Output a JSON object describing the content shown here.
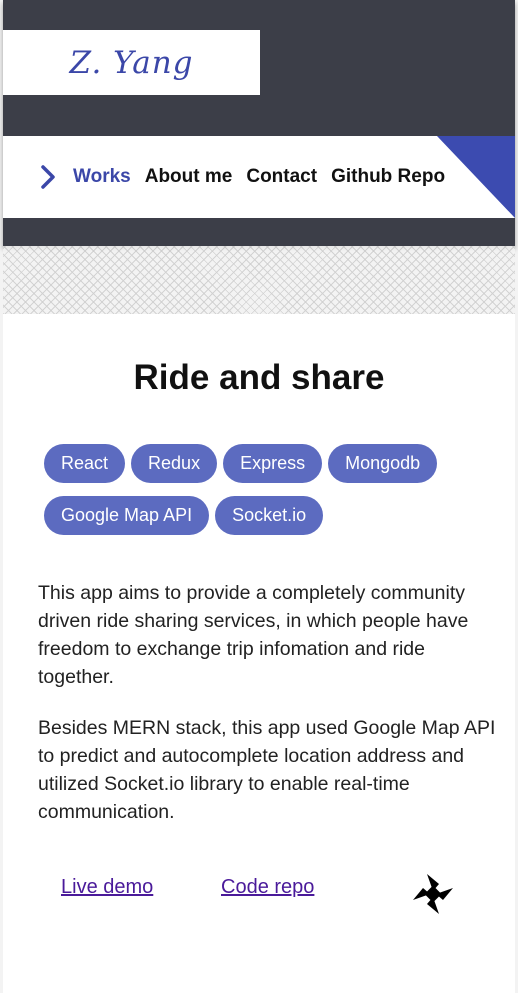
{
  "header": {
    "logo_text": "Z. Yang",
    "nav": {
      "items": [
        {
          "label": "Works",
          "active": true
        },
        {
          "label": "About me",
          "active": false
        },
        {
          "label": "Contact",
          "active": false
        },
        {
          "label": "Github Repo",
          "active": false
        }
      ]
    }
  },
  "project": {
    "title": "Ride and share",
    "tags": [
      "React",
      "Redux",
      "Express",
      "Mongodb",
      "Google Map API",
      "Socket.io"
    ],
    "description": [
      "This app aims to provide a completely community driven ride sharing services, in which people have freedom to exchange trip infomation and ride together.",
      "Besides MERN stack, this app used Google Map API to predict and autocomplete location address and utilized Socket.io library to enable real-time communication."
    ],
    "links": {
      "live_demo": "Live demo",
      "code_repo": "Code repo"
    }
  },
  "colors": {
    "header_bg": "#3c3e48",
    "accent": "#3b47a8",
    "tag_bg": "#5c6bc0",
    "link": "#4a1a9a"
  },
  "icons": {
    "nav_chevron": "chevron-right-icon",
    "loader": "pinwheel-spinner-icon"
  }
}
